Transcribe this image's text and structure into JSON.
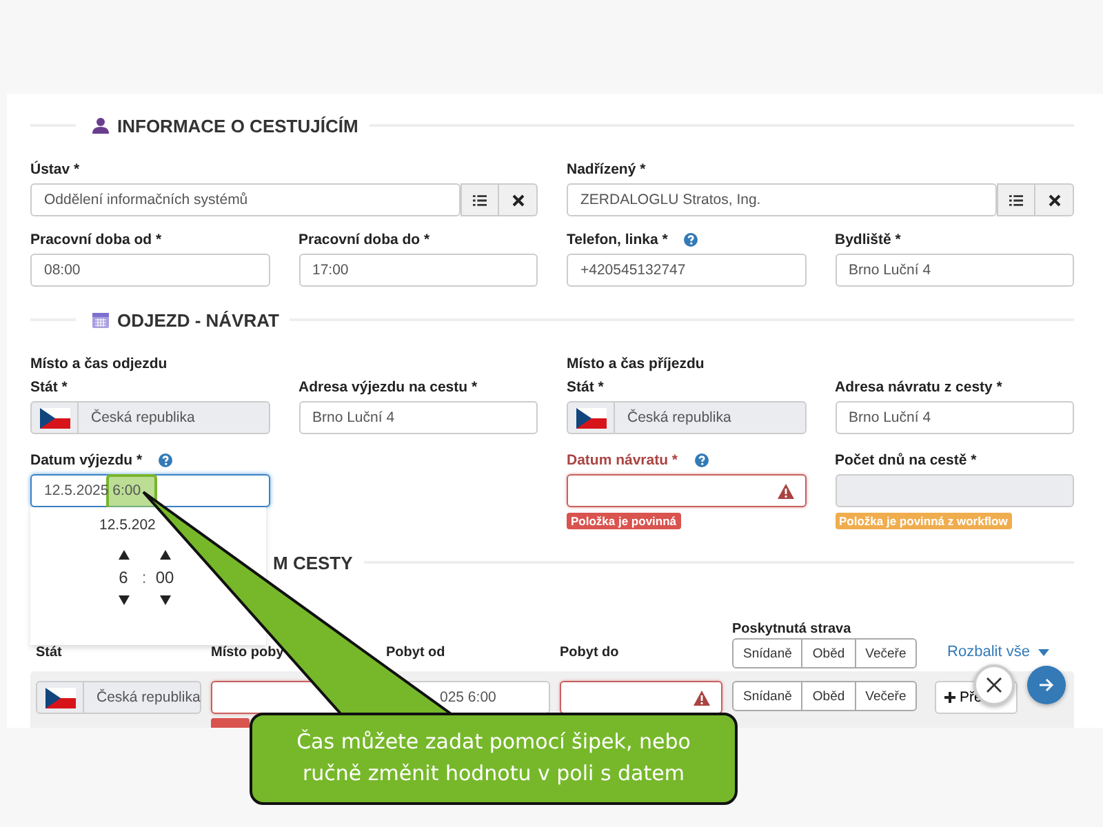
{
  "traveler_section": {
    "title": "INFORMACE O CESTUJÍCÍM",
    "fields": [
      {
        "kind": "lookup",
        "label": "Ústav *",
        "help": false,
        "value": "Oddělení informačních systémů"
      },
      {
        "kind": "lookup",
        "label": "Nadřízený *",
        "help": false,
        "value": "ZERDALOGLU Stratos, Ing."
      },
      {
        "kind": "text",
        "label": "Pracovní doba od *",
        "help": false,
        "value": "08:00"
      },
      {
        "kind": "text",
        "label": "Pracovní doba do *",
        "help": false,
        "value": "17:00"
      },
      {
        "kind": "text",
        "label": "Telefon, linka *",
        "help": true,
        "value": "+420545132747"
      },
      {
        "kind": "text",
        "label": "Bydliště *",
        "help": false,
        "value": "Brno Luční 4"
      }
    ]
  },
  "trip_section": {
    "title": "ODJEZD - NÁVRAT",
    "groups": [
      {
        "heading": "Místo a čas odjezdu",
        "fields": [
          {
            "kind": "country",
            "label": "Stát *",
            "help": false,
            "country": "Česká republika",
            "disabled": true,
            "invalid": false,
            "focused": false
          },
          {
            "kind": "text",
            "label": "Adresa výjezdu na cestu *",
            "help": false,
            "value": "Brno Luční 4",
            "disabled": false,
            "invalid": false,
            "focused": false
          },
          {
            "kind": "date",
            "label": "Datum výjezdu *",
            "help": true,
            "value": "12.5.2025 6:00",
            "disabled": false,
            "invalid": false,
            "focused": true
          }
        ]
      },
      {
        "heading": "Místo a čas příjezdu",
        "fields": [
          {
            "kind": "country",
            "label": "Stát *",
            "help": false,
            "country": "Česká republika",
            "disabled": true,
            "invalid": false,
            "focused": false
          },
          {
            "kind": "text",
            "label": "Adresa návratu z cesty *",
            "help": false,
            "value": "Brno Luční 4",
            "disabled": false,
            "invalid": false,
            "focused": false
          },
          {
            "kind": "date",
            "label": "Datum návratu *",
            "help": true,
            "disabled": false,
            "invalid": true,
            "focused": false,
            "message": {
              "text": "Položka je povinná",
              "color": "#d9534f"
            }
          },
          {
            "kind": "text",
            "label": "Počet dnů na cestě *",
            "help": false,
            "disabled": true,
            "invalid": false,
            "focused": false,
            "message": {
              "text": "Položka je povinná z workflow",
              "color": "#f0ad4e"
            }
          }
        ]
      }
    ]
  },
  "stays_section": {
    "title": "M CESTY",
    "meals_heading": "Poskytnutá strava",
    "meal_options": [
      "Snídaně",
      "Oběd",
      "Večeře"
    ],
    "columns": [
      "Stát",
      "Místo poby",
      "Pobyt od",
      "Pobyt do"
    ],
    "expand_all": "Rozbalit vše",
    "rows": [
      {
        "country": "Česká republika",
        "place_invalid": true,
        "from": "025 6:00",
        "to_invalid": true,
        "meals": [
          {
            "label": "Snídaně",
            "selected": false
          },
          {
            "label": "Oběd",
            "selected": false
          },
          {
            "label": "Večeře",
            "selected": false
          }
        ],
        "action": "Pře"
      }
    ]
  },
  "date_picker": {
    "date": "12.5.202",
    "hour": "6",
    "separator": ":",
    "minute": "00"
  },
  "tour": {
    "callout": "Čas můžete zadat pomocí šipek, nebo\nručně změnit hodnotu v poli s datem"
  }
}
